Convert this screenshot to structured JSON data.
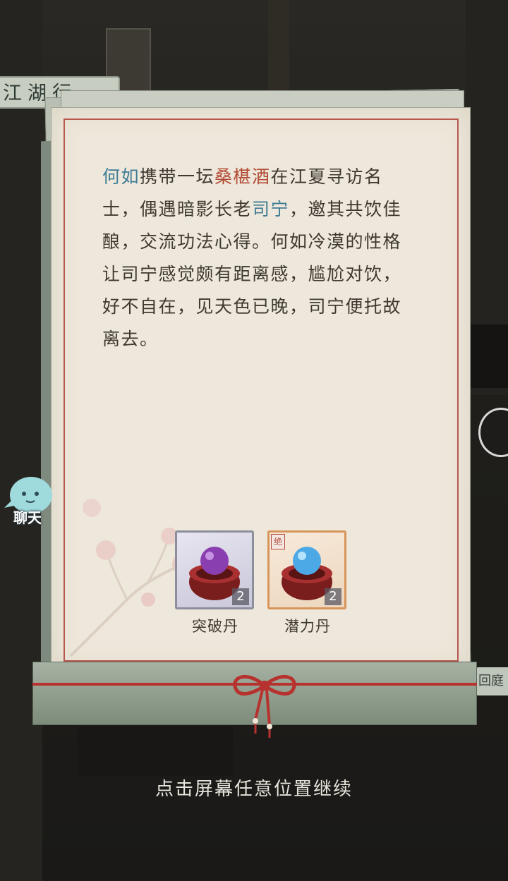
{
  "background": {
    "sign_left": "江湖行",
    "sign_right": "回庭"
  },
  "story": {
    "segments": [
      {
        "text": "何如",
        "style": "name"
      },
      {
        "text": "携带一坛",
        "style": "plain"
      },
      {
        "text": "桑椹酒",
        "style": "item"
      },
      {
        "text": "在江夏寻访名士，偶遇暗影长老",
        "style": "plain"
      },
      {
        "text": "司宁",
        "style": "name"
      },
      {
        "text": "，邀其共饮佳酿，交流功法心得。何如冷漠的性格让司宁感觉颇有距离感，尴尬对饮，好不自在，见天色已晚，司宁便托故离去。",
        "style": "plain"
      }
    ]
  },
  "rewards": [
    {
      "name": "突破丹",
      "count": "2",
      "frame": "purple",
      "orb_color": "#8a3fb0",
      "grade": ""
    },
    {
      "name": "潜力丹",
      "count": "2",
      "frame": "orange",
      "orb_color": "#4da9e6",
      "grade": "绝"
    }
  ],
  "continue_hint": "点击屏幕任意位置继续",
  "chat": {
    "label": "聊天"
  },
  "colors": {
    "name": "#3f7b93",
    "item": "#b24a33",
    "border": "#b9574e"
  }
}
